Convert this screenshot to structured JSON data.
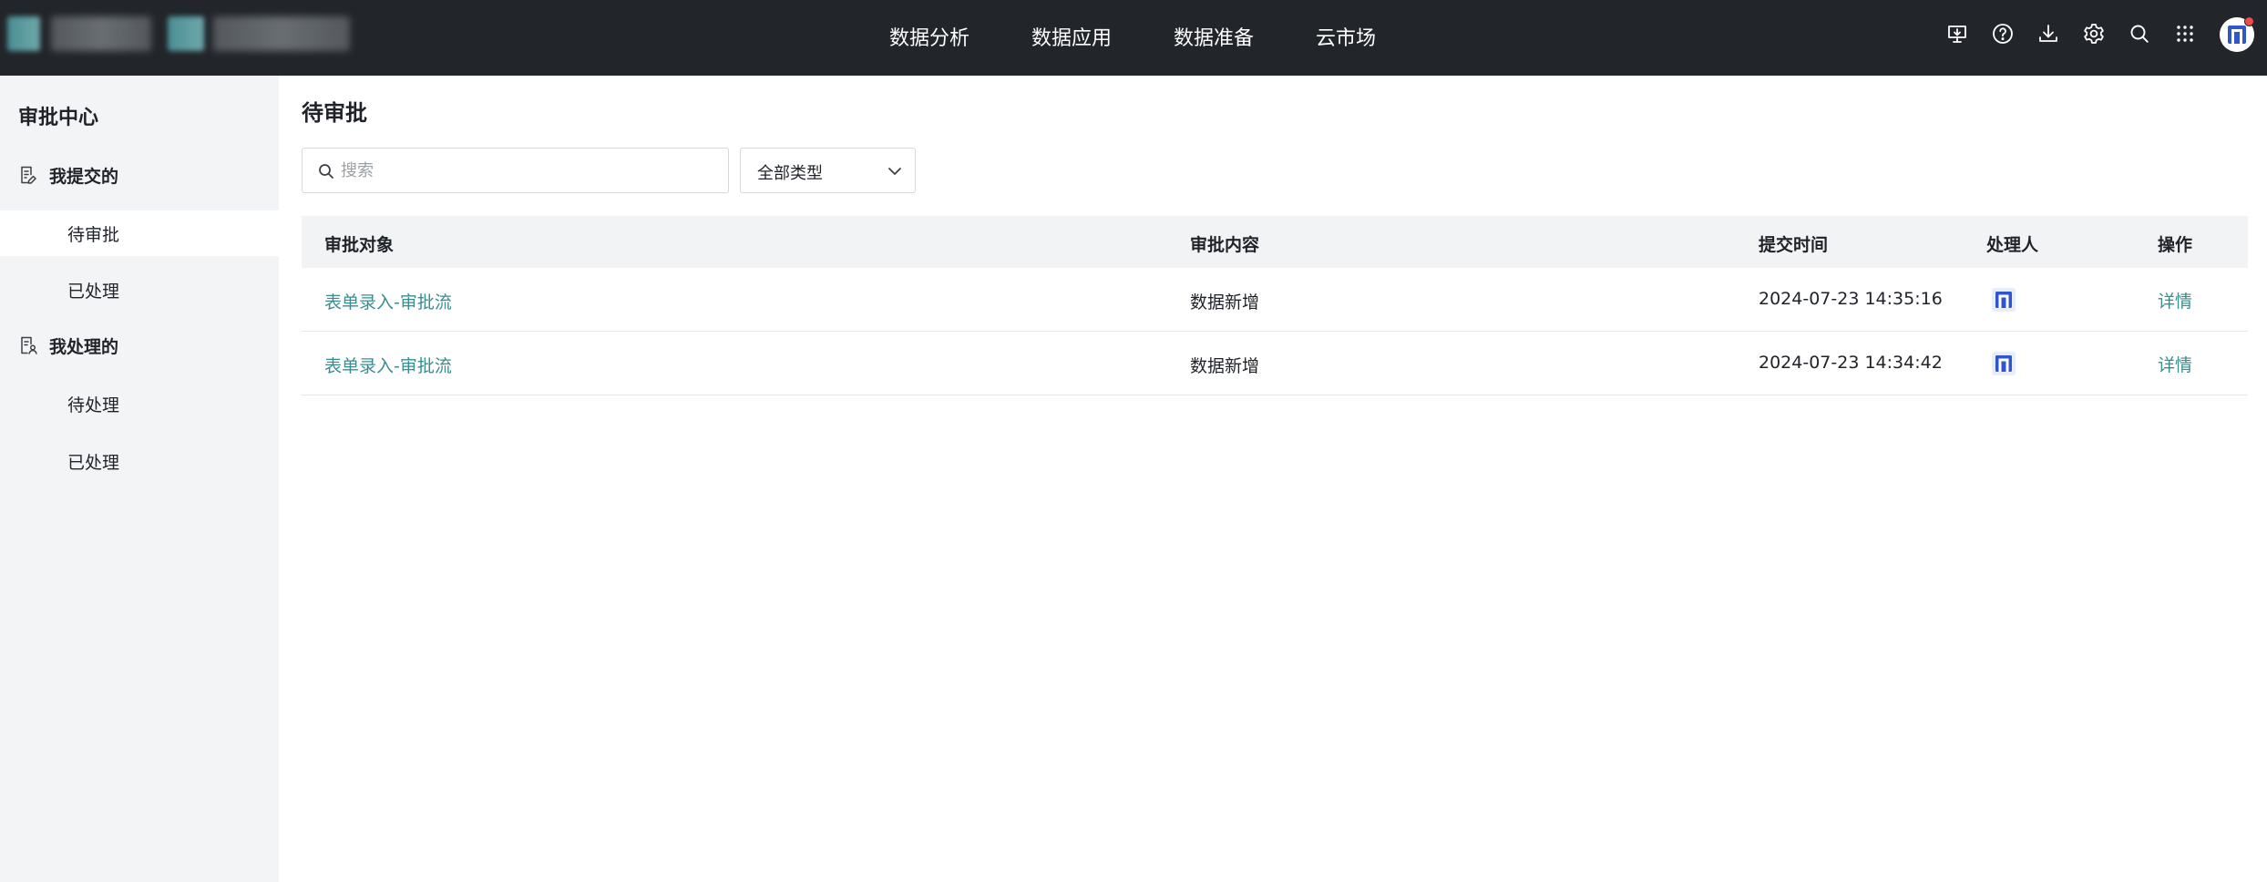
{
  "topbar": {
    "nav": [
      "数据分析",
      "数据应用",
      "数据准备",
      "云市场"
    ],
    "tools": [
      "monitor-download-icon",
      "help-icon",
      "download-icon",
      "gear-icon",
      "search-icon",
      "apps-grid-icon"
    ],
    "accent_color": "#22262b"
  },
  "sidebar": {
    "title": "审批中心",
    "groups": [
      {
        "label": "我提交的",
        "icon": "submit-doc-icon",
        "items": [
          {
            "label": "待审批",
            "active": true
          },
          {
            "label": "已处理",
            "active": false
          }
        ]
      },
      {
        "label": "我处理的",
        "icon": "handle-doc-icon",
        "items": [
          {
            "label": "待处理",
            "active": false
          },
          {
            "label": "已处理",
            "active": false
          }
        ]
      }
    ]
  },
  "main": {
    "title": "待审批",
    "search": {
      "placeholder": "搜索",
      "value": ""
    },
    "type_filter": {
      "selected": "全部类型"
    },
    "table": {
      "columns": [
        "审批对象",
        "审批内容",
        "提交时间",
        "处理人",
        "操作"
      ],
      "rows": [
        {
          "object": "表单录入-审批流",
          "content": "数据新增",
          "time": "2024-07-23 14:35:16",
          "action": "详情"
        },
        {
          "object": "表单录入-审批流",
          "content": "数据新增",
          "time": "2024-07-23 14:34:42",
          "action": "详情"
        }
      ]
    },
    "link_color": "#3a8d8f"
  }
}
